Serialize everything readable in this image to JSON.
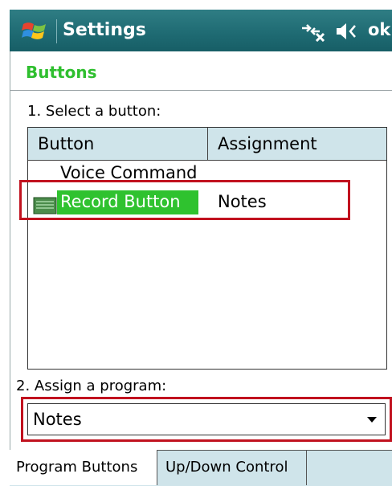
{
  "window": {
    "title": "Settings",
    "ok_label": "ok",
    "icons": [
      "windows-start-icon",
      "connectivity-icon",
      "volume-icon"
    ]
  },
  "page": {
    "heading": "Buttons"
  },
  "select_section": {
    "label": "1. Select a button:",
    "columns": [
      "Button",
      "Assignment"
    ],
    "rows": [
      {
        "button": "Voice Command",
        "assignment": ""
      },
      {
        "button": "Record Button",
        "assignment": "Notes",
        "selected": true
      }
    ]
  },
  "assign_section": {
    "label": "2. Assign a program:",
    "selected_program": "Notes"
  },
  "tabs": [
    {
      "label": "Program Buttons",
      "active": true
    },
    {
      "label": "Up/Down Control",
      "active": false
    }
  ],
  "colors": {
    "titlebar": "#1e6a72",
    "heading_green": "#2fbf2f",
    "selection_green": "#2fc22f",
    "highlight_red": "#c1121f",
    "header_bg": "#cfe4ea"
  }
}
